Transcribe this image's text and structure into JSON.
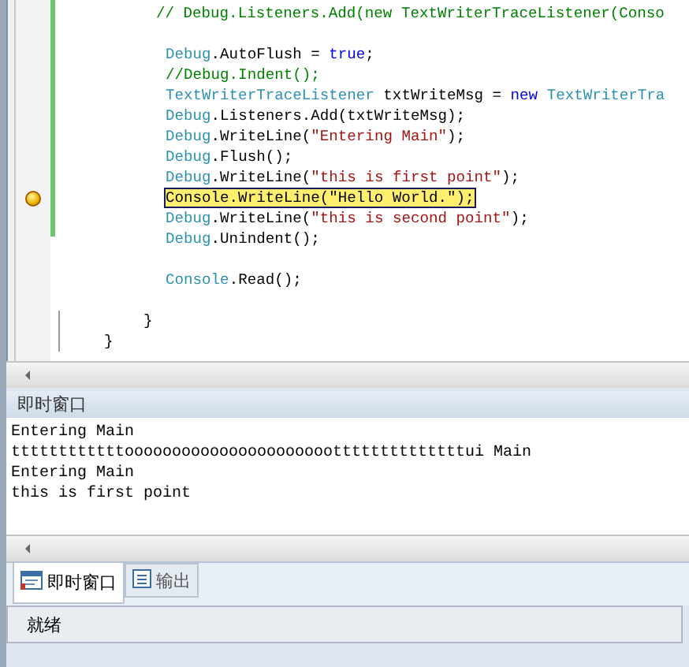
{
  "editor": {
    "lines": [
      {
        "kind": "comment-outer",
        "tokens": [
          {
            "kind": "comment",
            "text": "// Debug.Listeners.Add(new TextWriterTraceListener(Conso"
          }
        ]
      },
      {
        "kind": "blank"
      },
      {
        "kind": "statement",
        "tokens": [
          {
            "kind": "type",
            "text": "Debug"
          },
          {
            "kind": "plain",
            "text": ".AutoFlush = "
          },
          {
            "kind": "keyword",
            "text": "true"
          },
          {
            "kind": "plain",
            "text": ";"
          }
        ]
      },
      {
        "kind": "statement",
        "tokens": [
          {
            "kind": "comment",
            "text": "//Debug.Indent();"
          }
        ]
      },
      {
        "kind": "statement",
        "tokens": [
          {
            "kind": "type",
            "text": "TextWriterTraceListener"
          },
          {
            "kind": "plain",
            "text": " txtWriteMsg = "
          },
          {
            "kind": "keyword",
            "text": "new "
          },
          {
            "kind": "type",
            "text": "TextWriterTra"
          }
        ]
      },
      {
        "kind": "statement",
        "tokens": [
          {
            "kind": "type",
            "text": "Debug"
          },
          {
            "kind": "plain",
            "text": ".Listeners.Add(txtWriteMsg);"
          }
        ]
      },
      {
        "kind": "statement",
        "tokens": [
          {
            "kind": "type",
            "text": "Debug"
          },
          {
            "kind": "plain",
            "text": ".WriteLine("
          },
          {
            "kind": "string",
            "text": "\"Entering Main\""
          },
          {
            "kind": "plain",
            "text": ");"
          }
        ]
      },
      {
        "kind": "statement",
        "tokens": [
          {
            "kind": "type",
            "text": "Debug"
          },
          {
            "kind": "plain",
            "text": ".Flush();"
          }
        ]
      },
      {
        "kind": "statement",
        "tokens": [
          {
            "kind": "type",
            "text": "Debug"
          },
          {
            "kind": "plain",
            "text": ".WriteLine("
          },
          {
            "kind": "string",
            "text": "\"this is first point\""
          },
          {
            "kind": "plain",
            "text": ");"
          }
        ]
      },
      {
        "kind": "statement",
        "breakpoint": true,
        "tokens": [
          {
            "kind": "current",
            "text": "Console.WriteLine(\"Hello World.\");"
          }
        ]
      },
      {
        "kind": "statement",
        "tokens": [
          {
            "kind": "type",
            "text": "Debug"
          },
          {
            "kind": "plain",
            "text": ".WriteLine("
          },
          {
            "kind": "string",
            "text": "\"this is second point\""
          },
          {
            "kind": "plain",
            "text": ");"
          }
        ]
      },
      {
        "kind": "statement",
        "tokens": [
          {
            "kind": "type",
            "text": "Debug"
          },
          {
            "kind": "plain",
            "text": ".Unindent();"
          }
        ]
      },
      {
        "kind": "blank"
      },
      {
        "kind": "statement",
        "tokens": [
          {
            "kind": "type",
            "text": "Console"
          },
          {
            "kind": "plain",
            "text": ".Read();"
          }
        ]
      },
      {
        "kind": "blank"
      },
      {
        "kind": "brace-inner",
        "tokens": [
          {
            "kind": "plain",
            "text": "}"
          }
        ]
      },
      {
        "kind": "brace-outer",
        "tokens": [
          {
            "kind": "plain",
            "text": "}"
          }
        ]
      }
    ]
  },
  "immediate_window": {
    "title": "即时窗口",
    "lines": [
      "Entering Main",
      "ttttttttttttoooooooooooooooooooooottttttttttttttui Main",
      "Entering Main",
      "this is first point"
    ]
  },
  "tabs": [
    {
      "label": "即时窗口",
      "selected": true
    },
    {
      "label": "输出",
      "selected": false
    }
  ],
  "status_bar": "就绪"
}
